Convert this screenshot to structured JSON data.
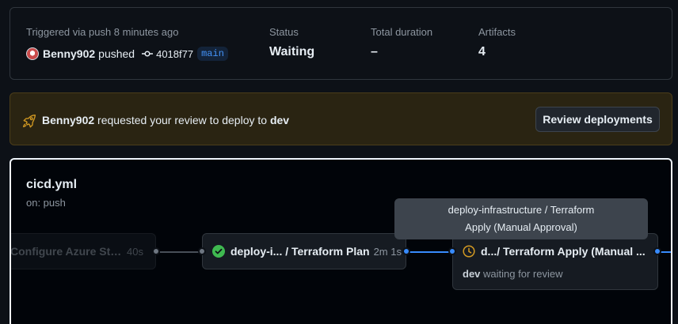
{
  "summary": {
    "trigger": "Triggered via push 8 minutes ago",
    "user": "Benny902",
    "verb": "pushed",
    "sha": "4018f77",
    "branch": "main",
    "status_label": "Status",
    "status_value": "Waiting",
    "duration_label": "Total duration",
    "duration_value": "–",
    "artifacts_label": "Artifacts",
    "artifacts_value": "4"
  },
  "review": {
    "user": "Benny902",
    "text_mid": "requested your review to deploy to",
    "env": "dev",
    "button": "Review deployments"
  },
  "workflow": {
    "name": "cicd.yml",
    "trigger": "on: push",
    "jobs": [
      {
        "title": "Configure Azure Stora...",
        "duration": "40s",
        "status": "success"
      },
      {
        "title": "deploy-i... / Terraform Plan",
        "duration": "2m 1s",
        "status": "success"
      },
      {
        "title": "d.../ Terraform Apply (Manual ...",
        "duration": "",
        "status": "waiting",
        "env": "dev",
        "sub_text": "waiting for review"
      }
    ],
    "tooltip_line1": "deploy-infrastructure / Terraform",
    "tooltip_line2": "Apply (Manual Approval)"
  },
  "colors": {
    "accent": "#388bfd",
    "success": "#3fb950",
    "waiting": "#d29922"
  }
}
